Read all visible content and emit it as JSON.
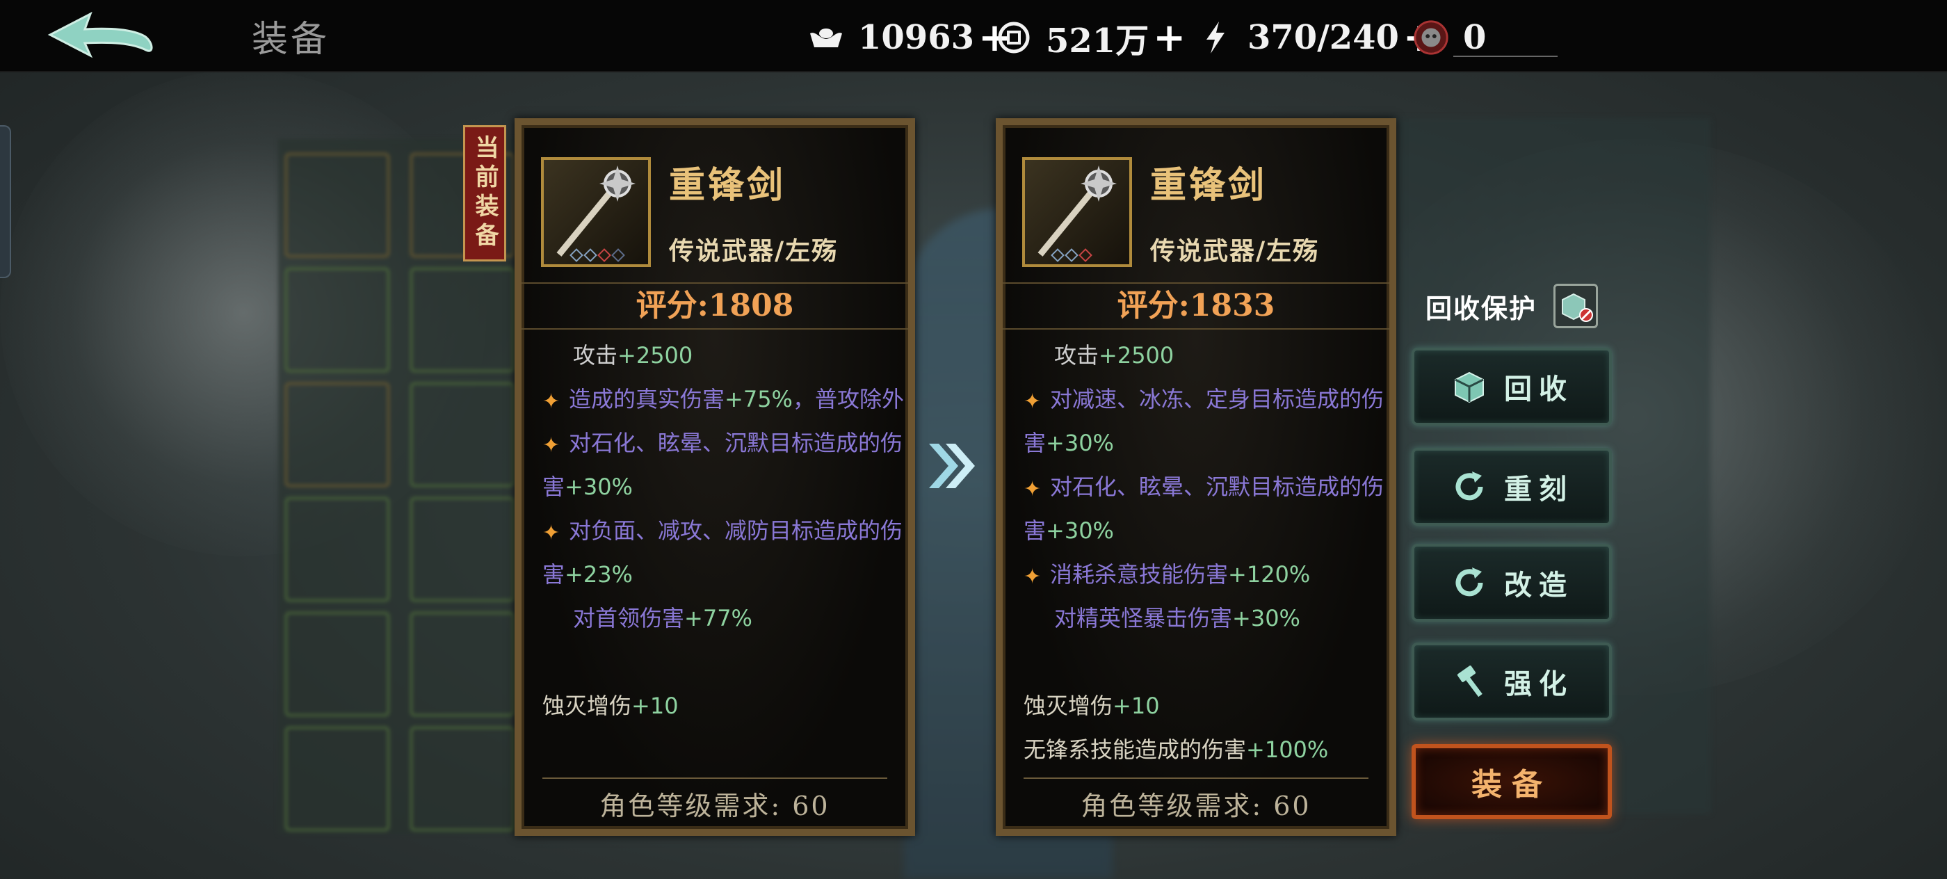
{
  "header": {
    "title": "装备",
    "resources": [
      {
        "icon": "silver-ingot-icon",
        "value": "10963",
        "plus": "+"
      },
      {
        "icon": "coin-icon",
        "value": "521万",
        "plus": "+"
      },
      {
        "icon": "stamina-bolt-icon",
        "value": "370/240",
        "plus": "+"
      },
      {
        "icon": "hero-medal-icon",
        "value": "0"
      }
    ]
  },
  "current_tag": "当前装备",
  "cards": [
    {
      "name": "重锋剑",
      "type": "传说武器/左殇",
      "score": "评分:1808",
      "stats": [
        {
          "label": "攻击",
          "value": "+2500",
          "kind": "base"
        },
        {
          "label": "造成的真实伤害",
          "value": "+75%",
          "suffix": "，普攻除外",
          "kind": "star"
        },
        {
          "label": "对石化、眩晕、沉默目标造成的伤害",
          "value": "+30%",
          "kind": "star"
        },
        {
          "label": "对负面、减攻、减防目标造成的伤害",
          "value": "+23%",
          "kind": "star"
        },
        {
          "label": "对首领伤害",
          "value": "+77%",
          "kind": "indent"
        },
        {
          "label": "",
          "value": "",
          "kind": "blank"
        },
        {
          "label": "蚀灭增伤",
          "value": "+10",
          "kind": "white"
        }
      ],
      "requirement": "角色等级需求:  60"
    },
    {
      "name": "重锋剑",
      "type": "传说武器/左殇",
      "score": "评分:1833",
      "stats": [
        {
          "label": "攻击",
          "value": "+2500",
          "kind": "base"
        },
        {
          "label": "对减速、冰冻、定身目标造成的伤害",
          "value": "+30%",
          "kind": "star"
        },
        {
          "label": "对石化、眩晕、沉默目标造成的伤害",
          "value": "+30%",
          "kind": "star"
        },
        {
          "label": "消耗杀意技能伤害",
          "value": "+120%",
          "kind": "star"
        },
        {
          "label": "对精英怪暴击伤害",
          "value": "+30%",
          "kind": "indent"
        },
        {
          "label": "",
          "value": "",
          "kind": "blank"
        },
        {
          "label": "蚀灭增伤",
          "value": "+10",
          "kind": "white"
        },
        {
          "label": "无锋系技能造成的伤害",
          "value": "+100%",
          "kind": "white"
        }
      ],
      "requirement": "角色等级需求:  60"
    }
  ],
  "side": {
    "recycle_protect_label": "回收保护",
    "buttons": [
      {
        "label": "回收",
        "icon": "recycle-box-icon"
      },
      {
        "label": "重刻",
        "icon": "refresh-icon"
      },
      {
        "label": "改造",
        "icon": "refresh-icon"
      },
      {
        "label": "强化",
        "icon": "hammer-icon"
      }
    ],
    "equip_label": "装备"
  },
  "colors": {
    "accent_gold": "#e9c27a",
    "score_orange": "#f1a256",
    "stat_purple": "#8a78d6",
    "stat_green": "#8ed2a0",
    "equip_orange": "#c1531d"
  }
}
